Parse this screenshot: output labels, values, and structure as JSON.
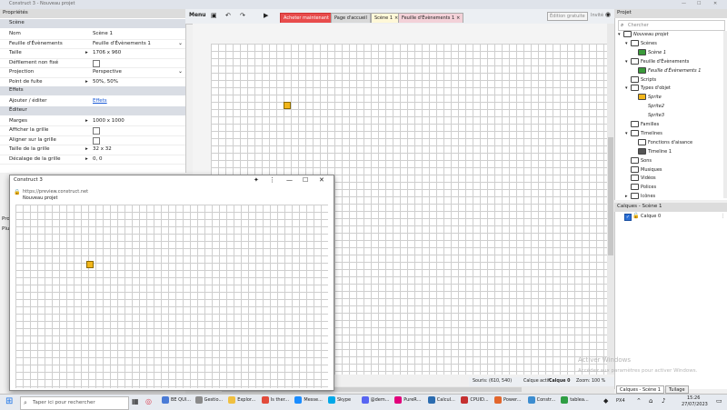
{
  "window": {
    "title": "Construct 3 - Nouveau projet"
  },
  "properties": {
    "header": "Propriétés",
    "sections": [
      {
        "title": "Scène",
        "rows": [
          {
            "key": "Nom",
            "value": "Scène 1",
            "type": "text"
          },
          {
            "key": "Feuille d'Évènements",
            "value": "Feuille d'Évènements 1",
            "type": "dropdown"
          },
          {
            "key": "Taille",
            "value": "1706 x 960",
            "type": "text",
            "icon": "triangle-right"
          },
          {
            "key": "Défilement non fixé",
            "value": "",
            "type": "checkbox"
          },
          {
            "key": "Projection",
            "value": "Perspective",
            "type": "dropdown"
          },
          {
            "key": "Point de fuite",
            "value": "50%, 50%",
            "type": "text",
            "icon": "triangle-right"
          }
        ]
      },
      {
        "title": "Effets",
        "rows": [
          {
            "key": "Ajouter / éditer",
            "value": "Effets",
            "type": "link"
          }
        ]
      },
      {
        "title": "Éditeur",
        "rows": [
          {
            "key": "Marges",
            "value": "1000 x 1000",
            "type": "text",
            "icon": "triangle-right"
          },
          {
            "key": "Afficher la grille",
            "value": "",
            "type": "checkbox"
          },
          {
            "key": "Aligner sur la grille",
            "value": "",
            "type": "checkbox"
          },
          {
            "key": "Taille de la grille",
            "value": "32 x 32",
            "type": "text",
            "icon": "triangle-right"
          },
          {
            "key": "Décalage de la grille",
            "value": "0, 0",
            "type": "text",
            "icon": "triangle-right"
          }
        ]
      }
    ],
    "side_labels": [
      "Pro",
      "Plu"
    ]
  },
  "toolbar": {
    "menu_label": "Menu",
    "tabs": [
      {
        "label": "Acheter maintenant",
        "style": "buy"
      },
      {
        "label": "Page d'accueil",
        "style": "home"
      },
      {
        "label": "Scène 1",
        "style": "scene",
        "close": "×"
      },
      {
        "label": "Feuille d'Évènements 1",
        "style": "event",
        "close": "×"
      }
    ],
    "edition_badge": "Édition gratuite",
    "guest_label": "Invité"
  },
  "project": {
    "header": "Projet",
    "search_placeholder": "Chercher",
    "tree": [
      {
        "label": "Nouveau projet",
        "level": 0,
        "arrow": "▾",
        "italic": true
      },
      {
        "label": "Scènes",
        "level": 1,
        "arrow": "▾"
      },
      {
        "label": "Scène 1",
        "level": 2,
        "arrow": "",
        "italic": true,
        "icon": "scene"
      },
      {
        "label": "Feuille d'Évènements",
        "level": 1,
        "arrow": "▾"
      },
      {
        "label": "Feuille d'Évènements 1",
        "level": 2,
        "arrow": "",
        "italic": true,
        "icon": "events"
      },
      {
        "label": "Scripts",
        "level": 1,
        "arrow": ""
      },
      {
        "label": "Types d'objet",
        "level": 1,
        "arrow": "▾"
      },
      {
        "label": "Sprite",
        "level": 2,
        "arrow": "",
        "italic": true,
        "icon": "sprite"
      },
      {
        "label": "Sprite2",
        "level": 2,
        "arrow": "",
        "italic": true,
        "icon": "none"
      },
      {
        "label": "Sprite3",
        "level": 2,
        "arrow": "",
        "italic": true,
        "icon": "none"
      },
      {
        "label": "Familles",
        "level": 1,
        "arrow": ""
      },
      {
        "label": "Timelines",
        "level": 1,
        "arrow": "▾"
      },
      {
        "label": "Fonctions d'aisance",
        "level": 2,
        "arrow": ""
      },
      {
        "label": "Timeline 1",
        "level": 2,
        "arrow": "",
        "icon": "timeline"
      },
      {
        "label": "Sons",
        "level": 1,
        "arrow": ""
      },
      {
        "label": "Musiques",
        "level": 1,
        "arrow": ""
      },
      {
        "label": "Vidéos",
        "level": 1,
        "arrow": ""
      },
      {
        "label": "Polices",
        "level": 1,
        "arrow": ""
      },
      {
        "label": "Icônes",
        "level": 1,
        "arrow": "▸"
      }
    ]
  },
  "layers": {
    "header": "Calques - Scène 1",
    "items": [
      {
        "label": "Calque 0",
        "locked": false,
        "visible": true
      }
    ],
    "bottom_tabs": [
      "Calques - Scène 1",
      "Tuilage"
    ]
  },
  "status": {
    "mouse": "Souris: (610, 540)",
    "active_layer_label": "Calque actif:",
    "active_layer": "Calque 0",
    "zoom": "Zoom: 100 %"
  },
  "preview": {
    "title": "Construct 3",
    "url": "https://preview.construct.net",
    "page_title": "Nouveau projet"
  },
  "watermark": {
    "line1": "Activer Windows",
    "line2": "Accédez aux paramètres pour activer Windows."
  },
  "taskbar": {
    "search_placeholder": "Taper ici pour rechercher",
    "apps": [
      {
        "label": "BE QUI...",
        "color": "#4a7bd6"
      },
      {
        "label": "Gestio...",
        "color": "#8a8a8a"
      },
      {
        "label": "Explor...",
        "color": "#f0c040"
      },
      {
        "label": "Is ther...",
        "color": "#e24b3b"
      },
      {
        "label": "Messe...",
        "color": "#1a8cff"
      },
      {
        "label": "Skype",
        "color": "#00a8e8"
      },
      {
        "label": "@dem...",
        "color": "#5865f2"
      },
      {
        "label": "PureR...",
        "color": "#e2007a"
      },
      {
        "label": "Calcul...",
        "color": "#2b6cb0"
      },
      {
        "label": "CPUID...",
        "color": "#c53030"
      },
      {
        "label": "Power...",
        "color": "#e2662c"
      },
      {
        "label": "Constr...",
        "color": "#3c8dd0"
      },
      {
        "label": "tablea...",
        "color": "#2f9e44"
      }
    ],
    "tray_label": "PX4",
    "time": "15:26",
    "date": "27/07/2023"
  },
  "colors": {
    "buy": "#e84c4c",
    "scene_tab": "#fff8d8",
    "event_tab": "#f3d1d8",
    "sprite": "#f2b61b",
    "link": "#1a5ad6"
  }
}
